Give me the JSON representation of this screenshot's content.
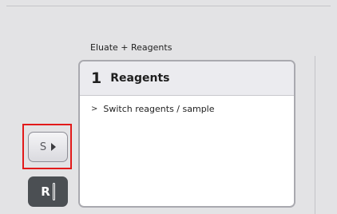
{
  "section": {
    "label": "Eluate + Reagents"
  },
  "panel": {
    "step_number": "1",
    "title": "Reagents",
    "items": [
      {
        "label": "Switch reagents / sample",
        "icon": "chevron-right-icon"
      }
    ]
  },
  "side_buttons": {
    "s_button": {
      "label": "S",
      "icon": "play-triangle-icon"
    },
    "r_button": {
      "label": "R",
      "icon": "tube-icon"
    }
  },
  "colors": {
    "highlight": "#e21a1a",
    "background": "#e3e3e5",
    "panel_header": "#ebebef",
    "r_button": "#4b4f53"
  }
}
